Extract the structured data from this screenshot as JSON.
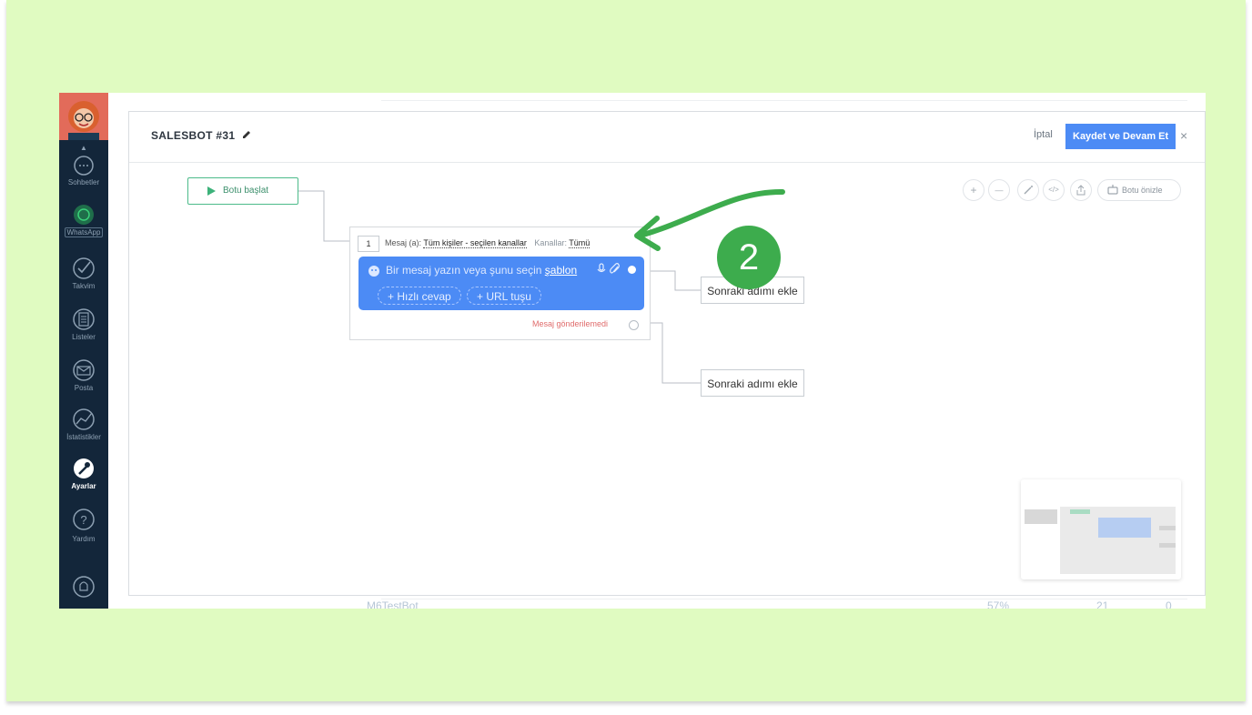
{
  "sidebar": {
    "items": [
      {
        "label": "Sohbetler",
        "icon": "chat-icon"
      },
      {
        "label": "WhatsApp",
        "icon": "whatsapp-icon"
      },
      {
        "label": "Takvim",
        "icon": "check-icon"
      },
      {
        "label": "Listeler",
        "icon": "list-icon"
      },
      {
        "label": "Posta",
        "icon": "mail-icon"
      },
      {
        "label": "İstatistikler",
        "icon": "stats-icon"
      },
      {
        "label": "Ayarlar",
        "icon": "wrench-icon"
      },
      {
        "label": "Yardım",
        "icon": "help-icon"
      }
    ]
  },
  "background": {
    "row_name": "M6TestBot",
    "row_pct": "57%",
    "row_count": "21",
    "row_zero": "0"
  },
  "header": {
    "title": "SALESBOT #31",
    "cancel_label": "İptal",
    "save_label": "Kaydet ve Devam Et",
    "close": "×"
  },
  "canvas": {
    "start_label": "Botu başlat",
    "block": {
      "step": "1",
      "type_label": "Mesaj (a):",
      "recipients": "Tüm kişiler - seçilen kanallar",
      "channels_label": "Kanallar:",
      "channels_value": "Tümü",
      "placeholder": "Bir mesaj yazın veya şunu seçin",
      "template_link": "şablon",
      "quick_reply": "+ Hızlı cevap",
      "url_button": "+ URL tuşu",
      "failed_label": "Mesaj gönderilemedi"
    },
    "next_step_1": "Sonraki adımı ekle",
    "next_step_2": "Sonraki adımı ekle",
    "tools": {
      "zoom_in": "+",
      "zoom_out": "—",
      "code": "</>",
      "preview_label": "Botu önizle"
    }
  },
  "annotation": {
    "step_badge": "2"
  },
  "colors": {
    "frame_bg": "#e0fbc1",
    "sidebar_bg": "#13263a",
    "primary": "#4c8bf5",
    "start_green": "#4cbb8a",
    "annotation_green": "#3dac4d",
    "error_red": "#e06b6b"
  }
}
